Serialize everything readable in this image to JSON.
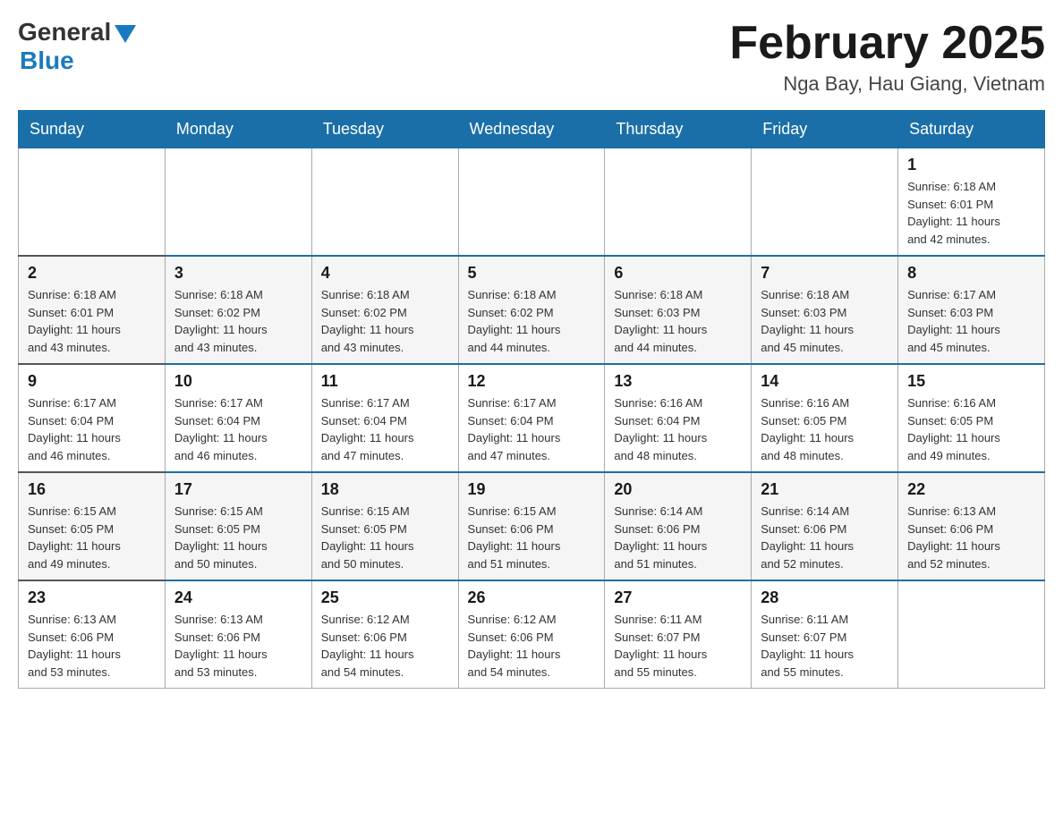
{
  "header": {
    "logo_general": "General",
    "logo_blue": "Blue",
    "month_title": "February 2025",
    "location": "Nga Bay, Hau Giang, Vietnam"
  },
  "days_of_week": [
    "Sunday",
    "Monday",
    "Tuesday",
    "Wednesday",
    "Thursday",
    "Friday",
    "Saturday"
  ],
  "weeks": [
    [
      {
        "date": "",
        "info": ""
      },
      {
        "date": "",
        "info": ""
      },
      {
        "date": "",
        "info": ""
      },
      {
        "date": "",
        "info": ""
      },
      {
        "date": "",
        "info": ""
      },
      {
        "date": "",
        "info": ""
      },
      {
        "date": "1",
        "info": "Sunrise: 6:18 AM\nSunset: 6:01 PM\nDaylight: 11 hours\nand 42 minutes."
      }
    ],
    [
      {
        "date": "2",
        "info": "Sunrise: 6:18 AM\nSunset: 6:01 PM\nDaylight: 11 hours\nand 43 minutes."
      },
      {
        "date": "3",
        "info": "Sunrise: 6:18 AM\nSunset: 6:02 PM\nDaylight: 11 hours\nand 43 minutes."
      },
      {
        "date": "4",
        "info": "Sunrise: 6:18 AM\nSunset: 6:02 PM\nDaylight: 11 hours\nand 43 minutes."
      },
      {
        "date": "5",
        "info": "Sunrise: 6:18 AM\nSunset: 6:02 PM\nDaylight: 11 hours\nand 44 minutes."
      },
      {
        "date": "6",
        "info": "Sunrise: 6:18 AM\nSunset: 6:03 PM\nDaylight: 11 hours\nand 44 minutes."
      },
      {
        "date": "7",
        "info": "Sunrise: 6:18 AM\nSunset: 6:03 PM\nDaylight: 11 hours\nand 45 minutes."
      },
      {
        "date": "8",
        "info": "Sunrise: 6:17 AM\nSunset: 6:03 PM\nDaylight: 11 hours\nand 45 minutes."
      }
    ],
    [
      {
        "date": "9",
        "info": "Sunrise: 6:17 AM\nSunset: 6:04 PM\nDaylight: 11 hours\nand 46 minutes."
      },
      {
        "date": "10",
        "info": "Sunrise: 6:17 AM\nSunset: 6:04 PM\nDaylight: 11 hours\nand 46 minutes."
      },
      {
        "date": "11",
        "info": "Sunrise: 6:17 AM\nSunset: 6:04 PM\nDaylight: 11 hours\nand 47 minutes."
      },
      {
        "date": "12",
        "info": "Sunrise: 6:17 AM\nSunset: 6:04 PM\nDaylight: 11 hours\nand 47 minutes."
      },
      {
        "date": "13",
        "info": "Sunrise: 6:16 AM\nSunset: 6:04 PM\nDaylight: 11 hours\nand 48 minutes."
      },
      {
        "date": "14",
        "info": "Sunrise: 6:16 AM\nSunset: 6:05 PM\nDaylight: 11 hours\nand 48 minutes."
      },
      {
        "date": "15",
        "info": "Sunrise: 6:16 AM\nSunset: 6:05 PM\nDaylight: 11 hours\nand 49 minutes."
      }
    ],
    [
      {
        "date": "16",
        "info": "Sunrise: 6:15 AM\nSunset: 6:05 PM\nDaylight: 11 hours\nand 49 minutes."
      },
      {
        "date": "17",
        "info": "Sunrise: 6:15 AM\nSunset: 6:05 PM\nDaylight: 11 hours\nand 50 minutes."
      },
      {
        "date": "18",
        "info": "Sunrise: 6:15 AM\nSunset: 6:05 PM\nDaylight: 11 hours\nand 50 minutes."
      },
      {
        "date": "19",
        "info": "Sunrise: 6:15 AM\nSunset: 6:06 PM\nDaylight: 11 hours\nand 51 minutes."
      },
      {
        "date": "20",
        "info": "Sunrise: 6:14 AM\nSunset: 6:06 PM\nDaylight: 11 hours\nand 51 minutes."
      },
      {
        "date": "21",
        "info": "Sunrise: 6:14 AM\nSunset: 6:06 PM\nDaylight: 11 hours\nand 52 minutes."
      },
      {
        "date": "22",
        "info": "Sunrise: 6:13 AM\nSunset: 6:06 PM\nDaylight: 11 hours\nand 52 minutes."
      }
    ],
    [
      {
        "date": "23",
        "info": "Sunrise: 6:13 AM\nSunset: 6:06 PM\nDaylight: 11 hours\nand 53 minutes."
      },
      {
        "date": "24",
        "info": "Sunrise: 6:13 AM\nSunset: 6:06 PM\nDaylight: 11 hours\nand 53 minutes."
      },
      {
        "date": "25",
        "info": "Sunrise: 6:12 AM\nSunset: 6:06 PM\nDaylight: 11 hours\nand 54 minutes."
      },
      {
        "date": "26",
        "info": "Sunrise: 6:12 AM\nSunset: 6:06 PM\nDaylight: 11 hours\nand 54 minutes."
      },
      {
        "date": "27",
        "info": "Sunrise: 6:11 AM\nSunset: 6:07 PM\nDaylight: 11 hours\nand 55 minutes."
      },
      {
        "date": "28",
        "info": "Sunrise: 6:11 AM\nSunset: 6:07 PM\nDaylight: 11 hours\nand 55 minutes."
      },
      {
        "date": "",
        "info": ""
      }
    ]
  ]
}
